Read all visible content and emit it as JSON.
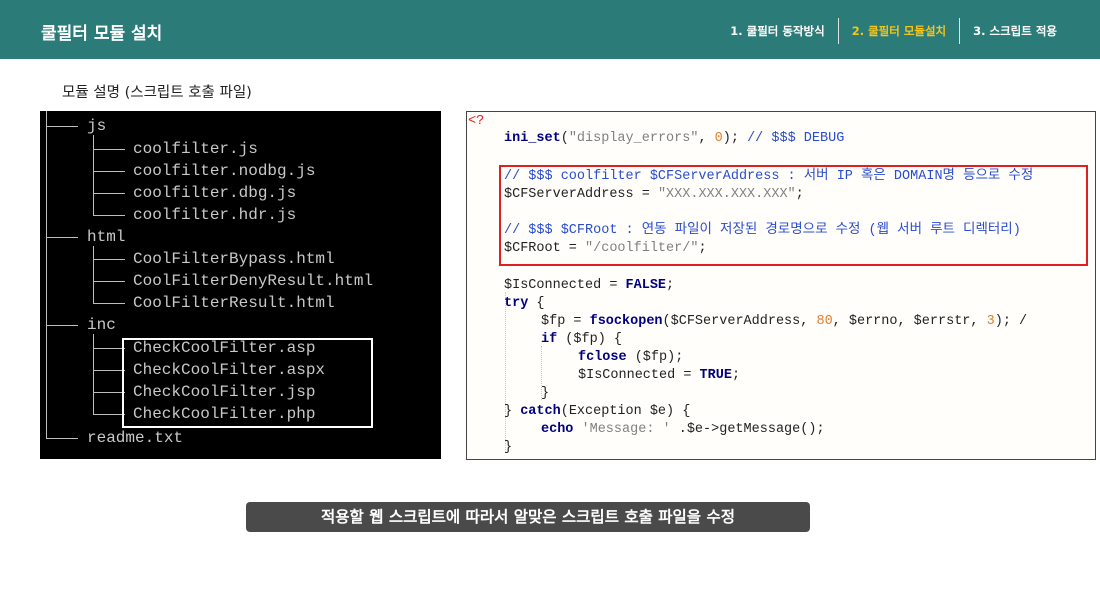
{
  "header": {
    "title": "쿨필터 모듈 설치",
    "nav": [
      {
        "label": "1. 쿨필터 동작방식",
        "active": false
      },
      {
        "label": "2. 쿨필터 모듈설치",
        "active": true
      },
      {
        "label": "3. 스크립트 적용",
        "active": false
      }
    ],
    "accent_color": "#2b7b78",
    "active_color": "#f5c518"
  },
  "subtitle": "모듈 설명 (스크립트 호출 파일)",
  "tree": {
    "js": "js",
    "js_files": [
      "coolfilter.js",
      "coolfilter.nodbg.js",
      "coolfilter.dbg.js",
      "coolfilter.hdr.js"
    ],
    "html": "html",
    "html_files": [
      "CoolFilterBypass.html",
      "CoolFilterDenyResult.html",
      "CoolFilterResult.html"
    ],
    "inc": "inc",
    "inc_files": [
      "CheckCoolFilter.asp",
      "CheckCoolFilter.aspx",
      "CheckCoolFilter.jsp",
      "CheckCoolFilter.php"
    ],
    "readme": "readme.txt"
  },
  "code": {
    "open_tag": "<?",
    "l1_fn": "ini_set",
    "l1_a": "(",
    "l1_str": "\"display_errors\"",
    "l1_b": ", ",
    "l1_num": "0",
    "l1_c": "); ",
    "l1_cmt": "// $$$ DEBUG",
    "l2_cmt": "// $$$ coolfilter $CFServerAddress : 서버 IP 혹은 DOMAIN명 등으로 수정",
    "l3_var": "$CFServerAddress = ",
    "l3_str": "\"XXX.XXX.XXX.XXX\"",
    "l3_end": ";",
    "l4_cmt": "// $$$ $CFRoot : 연동 파일이 저장된 경로명으로 수정 (웹 서버 루트 디렉터리)",
    "l5_var": "$CFRoot = ",
    "l5_str": "\"/coolfilter/\"",
    "l5_end": ";",
    "l6_var": "$IsConnected = ",
    "l6_kw": "FALSE",
    "l6_end": ";",
    "l7_kw": "try",
    "l7_end": " {",
    "l8_var": "$fp = ",
    "l8_fn": "fsockopen",
    "l8_a": "($CFServerAddress, ",
    "l8_num": "80",
    "l8_b": ", $errno, $errstr, ",
    "l8_num2": "3",
    "l8_c": "); /",
    "l9_kw": "if",
    "l9_end": " ($fp) {",
    "l10_fn": "fclose",
    "l10_end": " ($fp);",
    "l11_var": "$IsConnected = ",
    "l11_kw": "TRUE",
    "l11_end": ";",
    "l12": "}",
    "l13_a": "} ",
    "l13_kw": "catch",
    "l13_end": "(Exception $e) {",
    "l14_kw": "echo",
    "l14_str": " 'Message: '",
    "l14_end": " .$e->getMessage();",
    "l15": "}"
  },
  "caption": "적용할 웹 스크립트에 따라서 알맞은 스크립트 호출 파일을 수정"
}
